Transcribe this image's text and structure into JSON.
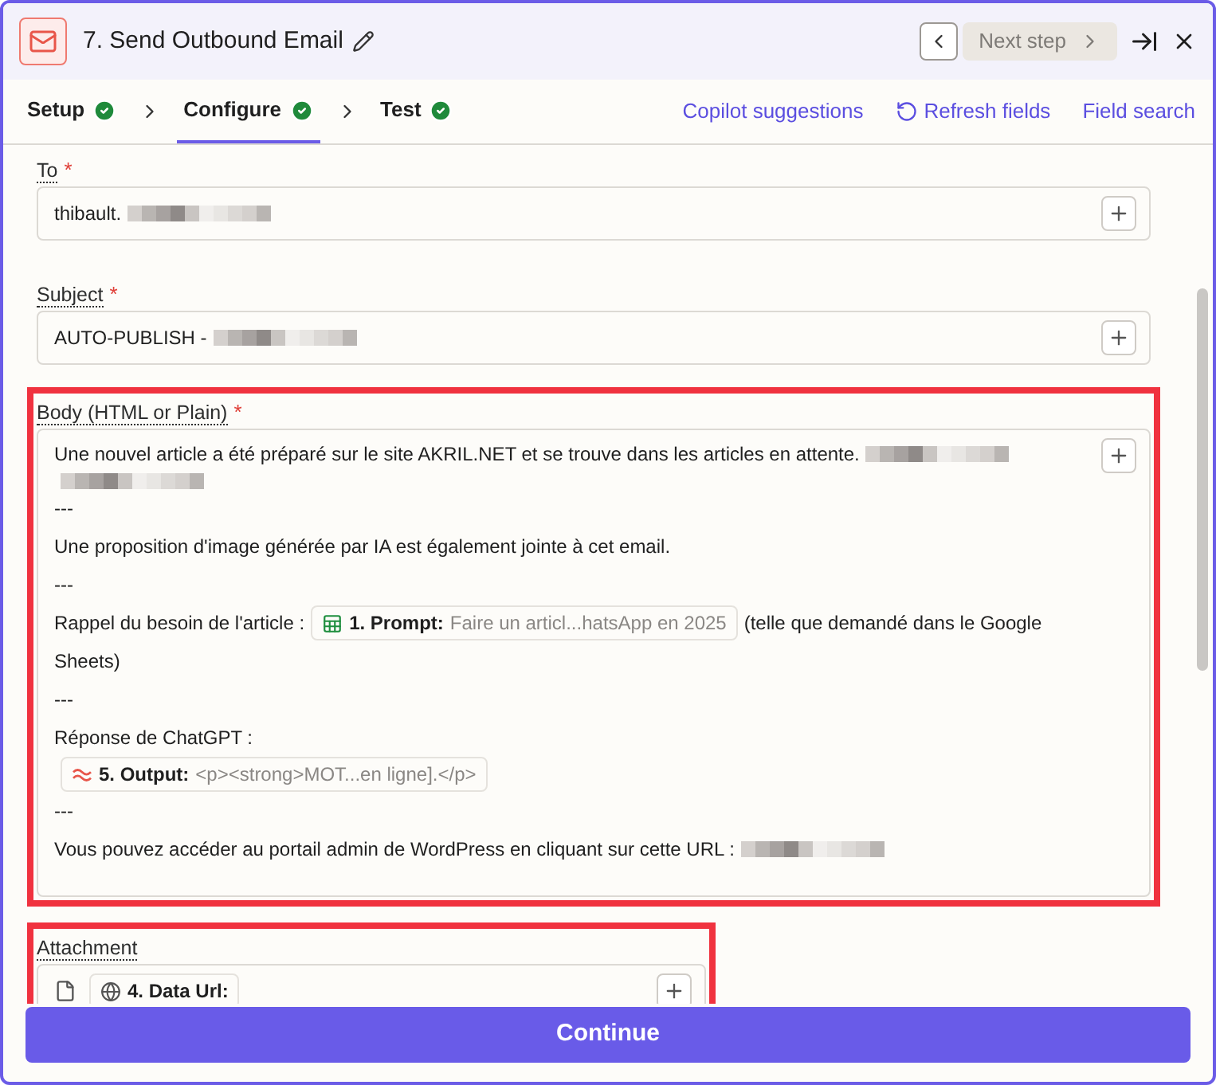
{
  "header": {
    "title": "7. Send Outbound Email",
    "next_step": "Next step"
  },
  "tabs": [
    {
      "label": "Setup",
      "selected": false,
      "done": true
    },
    {
      "label": "Configure",
      "selected": true,
      "done": true
    },
    {
      "label": "Test",
      "selected": false,
      "done": true
    }
  ],
  "actions": [
    {
      "kind": "link",
      "label": "Copilot suggestions"
    },
    {
      "kind": "refresh",
      "label": "Refresh fields"
    },
    {
      "kind": "link",
      "label": "Field search"
    }
  ],
  "fields": [
    {
      "label": "To",
      "required_mark": "*",
      "highlighted": false,
      "kind": "input",
      "lines": [
        [
          {
            "kind": "text",
            "text": "thibault."
          },
          {
            "kind": "redacted"
          }
        ]
      ]
    },
    {
      "label": "Subject",
      "required_mark": "*",
      "highlighted": false,
      "kind": "input",
      "lines": [
        [
          {
            "kind": "text",
            "text": "AUTO-PUBLISH -"
          },
          {
            "kind": "redacted"
          }
        ]
      ]
    },
    {
      "label": "Body (HTML or Plain)",
      "required_mark": "*",
      "highlighted": true,
      "kind": "area",
      "lines": [
        [
          {
            "kind": "text",
            "text": "Une nouvel article a été préparé sur le site AKRIL.NET et se trouve dans les articles en attente."
          },
          {
            "kind": "redacted"
          }
        ],
        [
          {
            "kind": "redacted"
          }
        ],
        [
          {
            "kind": "text",
            "text": "---"
          }
        ],
        [
          {
            "kind": "text",
            "text": "Une proposition d'image générée par IA est également jointe à cet email."
          }
        ],
        [
          {
            "kind": "text",
            "text": "---"
          }
        ],
        [
          {
            "kind": "text",
            "text": "Rappel du besoin de l'article :"
          },
          {
            "kind": "sheet",
            "label": "1. Prompt:",
            "value": "Faire un articl...hatsApp en 2025"
          },
          {
            "kind": "text",
            "text": "(telle que demandé dans le Google"
          }
        ],
        [
          {
            "kind": "text",
            "text": "Sheets)"
          }
        ],
        [
          {
            "kind": "text",
            "text": "---"
          }
        ],
        [
          {
            "kind": "text",
            "text": "Réponse de ChatGPT :"
          }
        ],
        [
          {
            "kind": "ai",
            "label": "5. Output:",
            "value": "<p><strong>MOT...en ligne].</p>"
          }
        ],
        [
          {
            "kind": "text",
            "text": "---"
          }
        ],
        [
          {
            "kind": "text",
            "text": "Vous pouvez accéder au portail admin de WordPress en cliquant sur cette URL :"
          },
          {
            "kind": "redacted"
          }
        ]
      ]
    },
    {
      "label": "Attachment",
      "highlighted": true,
      "kind": "file",
      "lines": [
        [
          {
            "kind": "web",
            "label": "4. Data Url:"
          }
        ]
      ]
    }
  ],
  "continue": "Continue"
}
